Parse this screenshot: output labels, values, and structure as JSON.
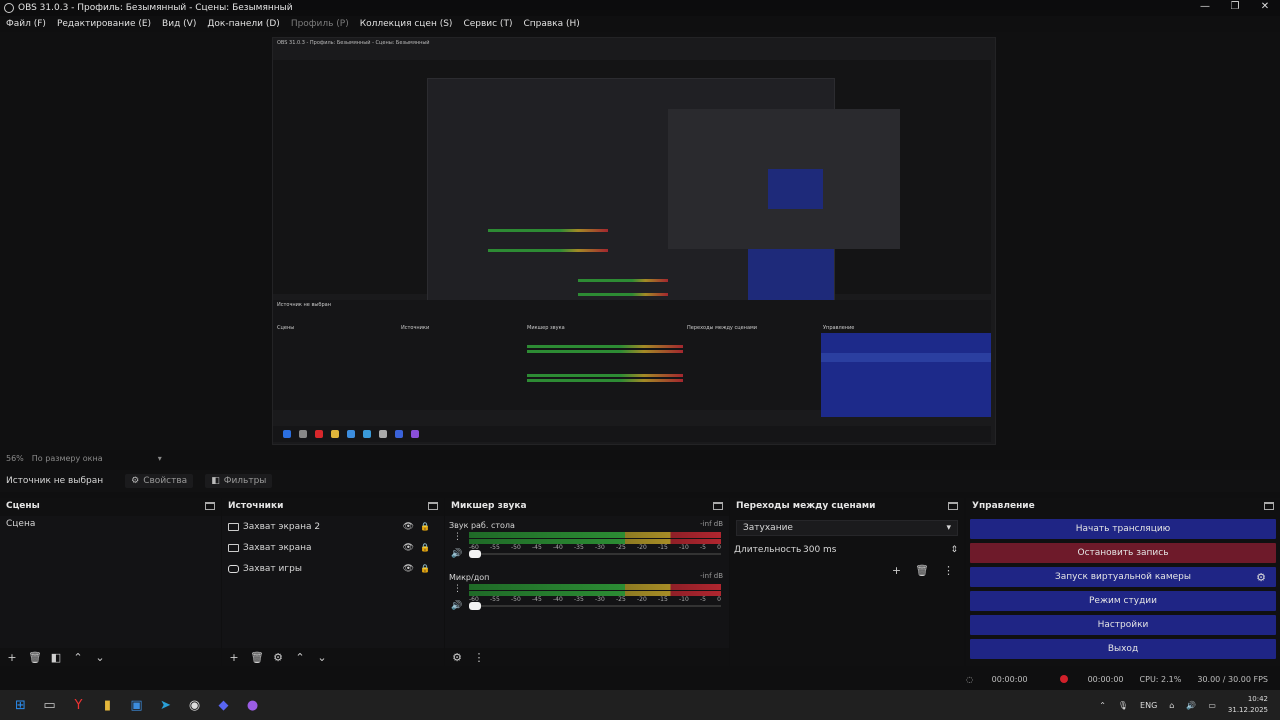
{
  "window": {
    "title": "OBS 31.0.3 - Профиль: Безымянный - Сцены: Безымянный",
    "controls": [
      "—",
      "❐",
      "✕"
    ]
  },
  "menu": [
    {
      "label": "Файл (F)",
      "enabled": true
    },
    {
      "label": "Редактирование (E)",
      "enabled": true
    },
    {
      "label": "Вид (V)",
      "enabled": true
    },
    {
      "label": "Док-панели (D)",
      "enabled": true
    },
    {
      "label": "Профиль (P)",
      "enabled": false
    },
    {
      "label": "Коллекция сцен (S)",
      "enabled": true
    },
    {
      "label": "Сервис (T)",
      "enabled": true
    },
    {
      "label": "Справка (H)",
      "enabled": true
    }
  ],
  "scale": {
    "zoom": "56%",
    "mode": "По размеру окна"
  },
  "context": {
    "no_source": "Источник не выбран",
    "properties": "Свойства",
    "filters": "Фильтры"
  },
  "docks": {
    "scenes": {
      "title": "Сцены",
      "items": [
        "Сцена"
      ]
    },
    "sources": {
      "title": "Источники",
      "items": [
        {
          "name": "Захват экрана 2",
          "icon": "monitor-icon"
        },
        {
          "name": "Захват экрана",
          "icon": "monitor-icon"
        },
        {
          "name": "Захват игры",
          "icon": "gamepad-icon"
        }
      ]
    },
    "mixer": {
      "title": "Микшер звука",
      "channels": [
        {
          "name": "Звук раб. стола",
          "db": "-inf dB"
        },
        {
          "name": "Микр/доп",
          "db": "-inf dB"
        }
      ],
      "ticks": [
        "-60",
        "-55",
        "-50",
        "-45",
        "-40",
        "-35",
        "-30",
        "-25",
        "-20",
        "-15",
        "-10",
        "-5",
        "0"
      ]
    },
    "transitions": {
      "title": "Переходы между сценами",
      "selected": "Затухание",
      "duration_label": "Длительность",
      "duration": "300 ms"
    },
    "controls": {
      "title": "Управление",
      "buttons": [
        {
          "label": "Начать трансляцию"
        },
        {
          "label": "Остановить запись"
        },
        {
          "label": "Запуск виртуальной камеры"
        },
        {
          "label": "Режим студии"
        },
        {
          "label": "Настройки"
        },
        {
          "label": "Выход"
        }
      ]
    }
  },
  "status": {
    "stream_time": "00:00:00",
    "rec_time": "00:00:00",
    "cpu": "CPU: 2.1%",
    "fps": "30.00 / 30.00 FPS"
  },
  "taskbar": {
    "lang": "ENG",
    "time": "10:42",
    "date": "31.12.2025"
  },
  "nested": {
    "title": "OBS 31.0.3 - Профиль: Безымянный - Сцены: Безымянный",
    "scenes": "Сцены",
    "sources": "Источники",
    "mixer": "Микшер звука",
    "transitions": "Переходы между сценами",
    "controls": "Управление",
    "no_source": "Источник не выбран"
  },
  "colors": {
    "accent": "#1f2585",
    "recording": "#6e1a2a",
    "meter_green": "#2c8d34",
    "meter_yellow": "#a88d26",
    "meter_red": "#b0262f"
  }
}
